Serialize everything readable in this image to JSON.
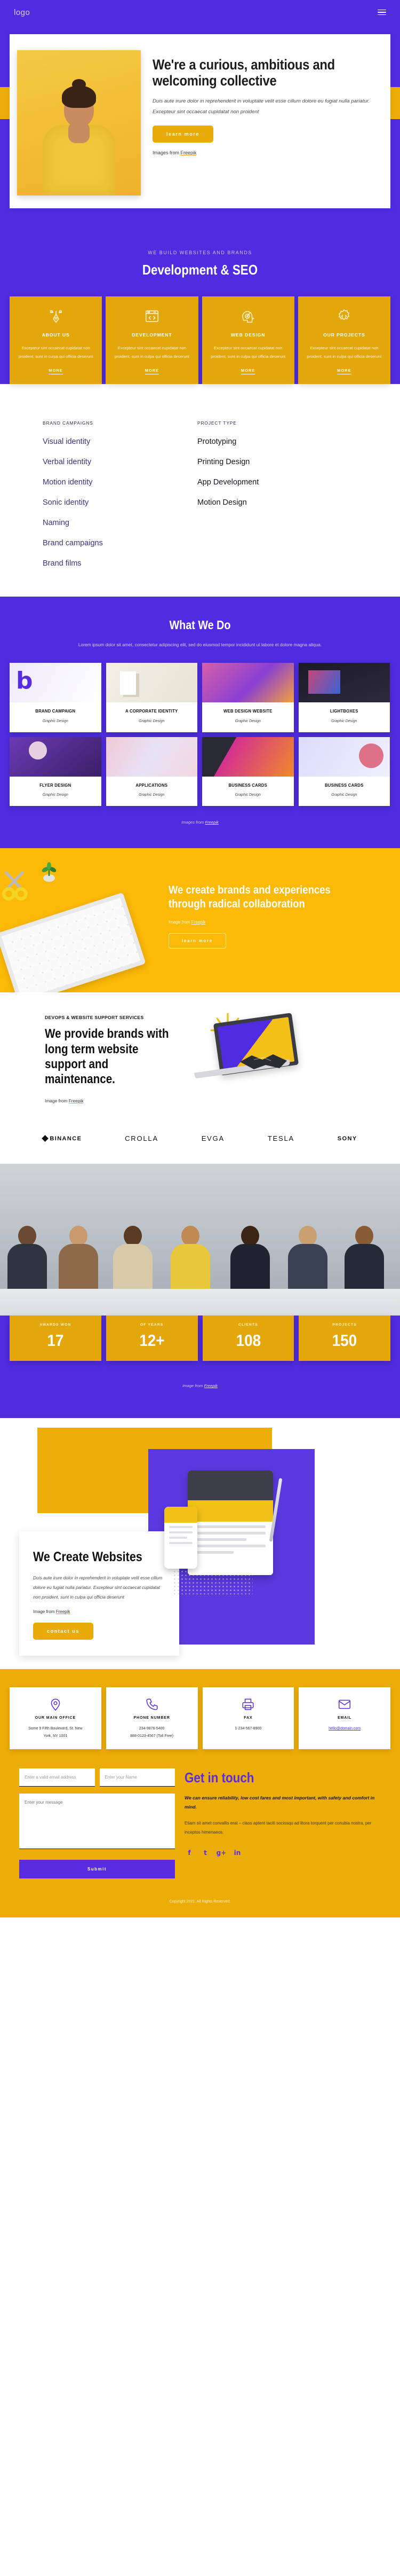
{
  "header": {
    "logo": "logo",
    "menu_icon": "hamburger-menu-icon"
  },
  "hero": {
    "title": "We're a curious, ambitious and welcoming collective",
    "subtitle": "Duis aute irure dolor in reprehenderit in voluptate velit esse cillum dolore eu fugiat nulla pariatur. Excepteur sint occaecat cupidatat non proident",
    "button": "learn more",
    "credit_prefix": "Images from ",
    "credit_link": "Freepik"
  },
  "development": {
    "kicker": "WE BUILD WEBSITES AND BRANDS",
    "title": "Development & SEO",
    "cards": [
      {
        "icon": "pen-tool-icon",
        "title": "ABOUT US",
        "desc": "Excepteur sint occaecat cupidatat non proident, sunt in culpa qui officia deserunt",
        "more": "MORE"
      },
      {
        "icon": "code-window-icon",
        "title": "DEVELOPMENT",
        "desc": "Excepteur sint occaecat cupidatat non proident, sunt in culpa qui officia deserunt",
        "more": "MORE"
      },
      {
        "icon": "head-target-icon",
        "title": "WEB DESIGN",
        "desc": "Excepteur sint occaecat cupidatat non proident, sunt in culpa qui officia deserunt",
        "more": "MORE"
      },
      {
        "icon": "gear-code-icon",
        "title": "OUR PROJECTS",
        "desc": "Excepteur sint occaecat cupidatat non proident, sunt in culpa qui officia deserunt",
        "more": "MORE"
      }
    ]
  },
  "lists": {
    "left_head": "BRAND CAMPAIGNS",
    "left_items": [
      "Visual identity",
      "Verbal identity",
      "Motion identity",
      "Sonic identity",
      "Naming",
      "Brand campaigns",
      "Brand films"
    ],
    "right_head": "PROJECT TYPE",
    "right_items": [
      "Prototyping",
      "Printing Design",
      "App Development",
      "Motion Design"
    ]
  },
  "what_we_do": {
    "title": "What We Do",
    "subtitle": "Lorem ipsum dolor sit amet, consectetur adipiscing elit, sed do eiusmod tempor incididunt ut labore et dolore magna aliqua.",
    "tiles": [
      {
        "name": "BRAND CAMPAIGN",
        "category": "Graphic Design"
      },
      {
        "name": "A CORPORATE IDENTITY",
        "category": "Graphic Design"
      },
      {
        "name": "WEB DESIGN WEBSITE",
        "category": "Graphic Design"
      },
      {
        "name": "LIGHTBOXES",
        "category": "Graphic Design"
      },
      {
        "name": "FLYER DESIGN",
        "category": "Graphic Design"
      },
      {
        "name": "APPLICATIONS",
        "category": "Graphic Design"
      },
      {
        "name": "BUSINESS CARDS",
        "category": "Graphic Design"
      },
      {
        "name": "BUSINESS CARDS",
        "category": "Graphic Design"
      }
    ],
    "credit_prefix": "Images from ",
    "credit_link": "Freepik"
  },
  "brands_band": {
    "title": "We create brands and experiences through radical collaboration",
    "credit_prefix": "Image from ",
    "credit_link": "Freepik",
    "button": "learn more"
  },
  "devops": {
    "kicker": "DEVOPS & WEBSITE SUPPORT SERVICES",
    "title": "We provide brands with long term website support and maintenance.",
    "credit_prefix": "Image from ",
    "credit_link": "Freepik"
  },
  "clients": [
    "BINANCE",
    "CROLLA",
    "EVGA",
    "TESLA",
    "SONY"
  ],
  "stats": {
    "items": [
      {
        "label": "AWARDS WON",
        "value": "17"
      },
      {
        "label": "OF YEARS",
        "value": "12+"
      },
      {
        "label": "CLIENTS",
        "value": "108"
      },
      {
        "label": "PROJECTS",
        "value": "150"
      }
    ],
    "credit_prefix": "Image from ",
    "credit_link": "Freepik"
  },
  "we_create": {
    "title": "We Create Websites",
    "body": "Duis aute irure dolor in reprehenderit in voluptate velit esse cillum dolore eu fugiat nulla pariatur. Excepteur sint occaecat cupidatat non proident, sunt in culpa qui officia deserunt",
    "credit_prefix": "Image from ",
    "credit_link": "Freepik",
    "button": "contact us"
  },
  "contact_cards": [
    {
      "icon": "location-pin-icon",
      "title": "OUR MAIN OFFICE",
      "line1": "Some 9 Fifth Boulevard, St. New",
      "line2": "York, NY 1001"
    },
    {
      "icon": "phone-icon",
      "title": "PHONE NUMBER",
      "line1": "234-9876-5400",
      "line2": "888-0123-4567 (Toll Free)"
    },
    {
      "icon": "fax-icon",
      "title": "FAX",
      "line1": "1-234-567-8900",
      "line2": ""
    },
    {
      "icon": "envelope-icon",
      "title": "EMAIL",
      "line1": "hello@domain.com",
      "line2": ""
    }
  ],
  "get_in_touch": {
    "title": "Get in touch",
    "lead": "We can ensure reliability, low cost fares and most important, with safety and comfort in mind.",
    "body": "Etiam sit amet convallis erat – class aptent taciti sociosqu ad litora torquent per conubia nostra, per inceptos himenaeos.",
    "email_placeholder": "Enter a valid email address",
    "name_placeholder": "Enter your Name",
    "message_placeholder": "Enter your message",
    "submit": "Submit",
    "socials": [
      "facebook-icon",
      "twitter-icon",
      "google-plus-icon",
      "linkedin-icon"
    ]
  },
  "footer": {
    "text": "Copyright 2021. All Rights Reserved."
  },
  "colors": {
    "purple": "#4f2ce0",
    "yellow": "#edad08",
    "amber": "#fbb908"
  }
}
